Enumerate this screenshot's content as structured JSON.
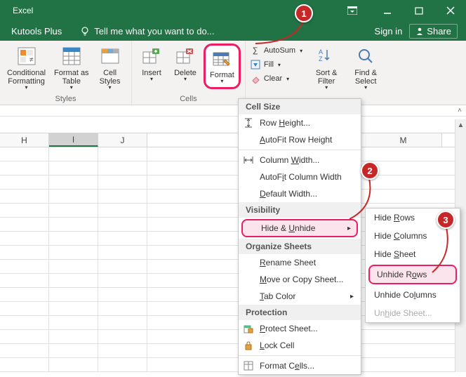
{
  "titlebar": {
    "app_name": "Excel"
  },
  "menubar": {
    "tab1": "Kutools Plus",
    "tell_me": "Tell me what you want to do...",
    "sign_in": "Sign in",
    "share": "Share"
  },
  "ribbon": {
    "conditional_formatting": "Conditional\nFormatting",
    "format_as_table": "Format as\nTable",
    "cell_styles": "Cell\nStyles",
    "styles_group": "Styles",
    "insert": "Insert",
    "delete": "Delete",
    "format": "Format",
    "cells_group": "Cells",
    "autosum": "AutoSum",
    "fill": "Fill",
    "clear": "Clear",
    "sort_filter": "Sort &\nFilter",
    "find_select": "Find &\nSelect"
  },
  "columns": {
    "H": "H",
    "I": "I",
    "J": "J",
    "M": "M"
  },
  "dropdown": {
    "cell_size": "Cell Size",
    "row_height": "Row Height...",
    "autofit_row_height": "AutoFit Row Height",
    "column_width": "Column Width...",
    "autofit_column_width": "AutoFit Column Width",
    "default_width": "Default Width...",
    "visibility": "Visibility",
    "hide_unhide": "Hide & Unhide",
    "organize_sheets": "Organize Sheets",
    "rename_sheet": "Rename Sheet",
    "move_copy_sheet": "Move or Copy Sheet...",
    "tab_color": "Tab Color",
    "protection": "Protection",
    "protect_sheet": "Protect Sheet...",
    "lock_cell": "Lock Cell",
    "format_cells": "Format Cells..."
  },
  "submenu": {
    "hide_rows": "Hide Rows",
    "hide_columns": "Hide Columns",
    "hide_sheet": "Hide Sheet",
    "unhide_rows": "Unhide Rows",
    "unhide_columns": "Unhide Columns",
    "unhide_sheet": "Unhide Sheet..."
  },
  "annotations": {
    "a1": "1",
    "a2": "2",
    "a3": "3"
  }
}
